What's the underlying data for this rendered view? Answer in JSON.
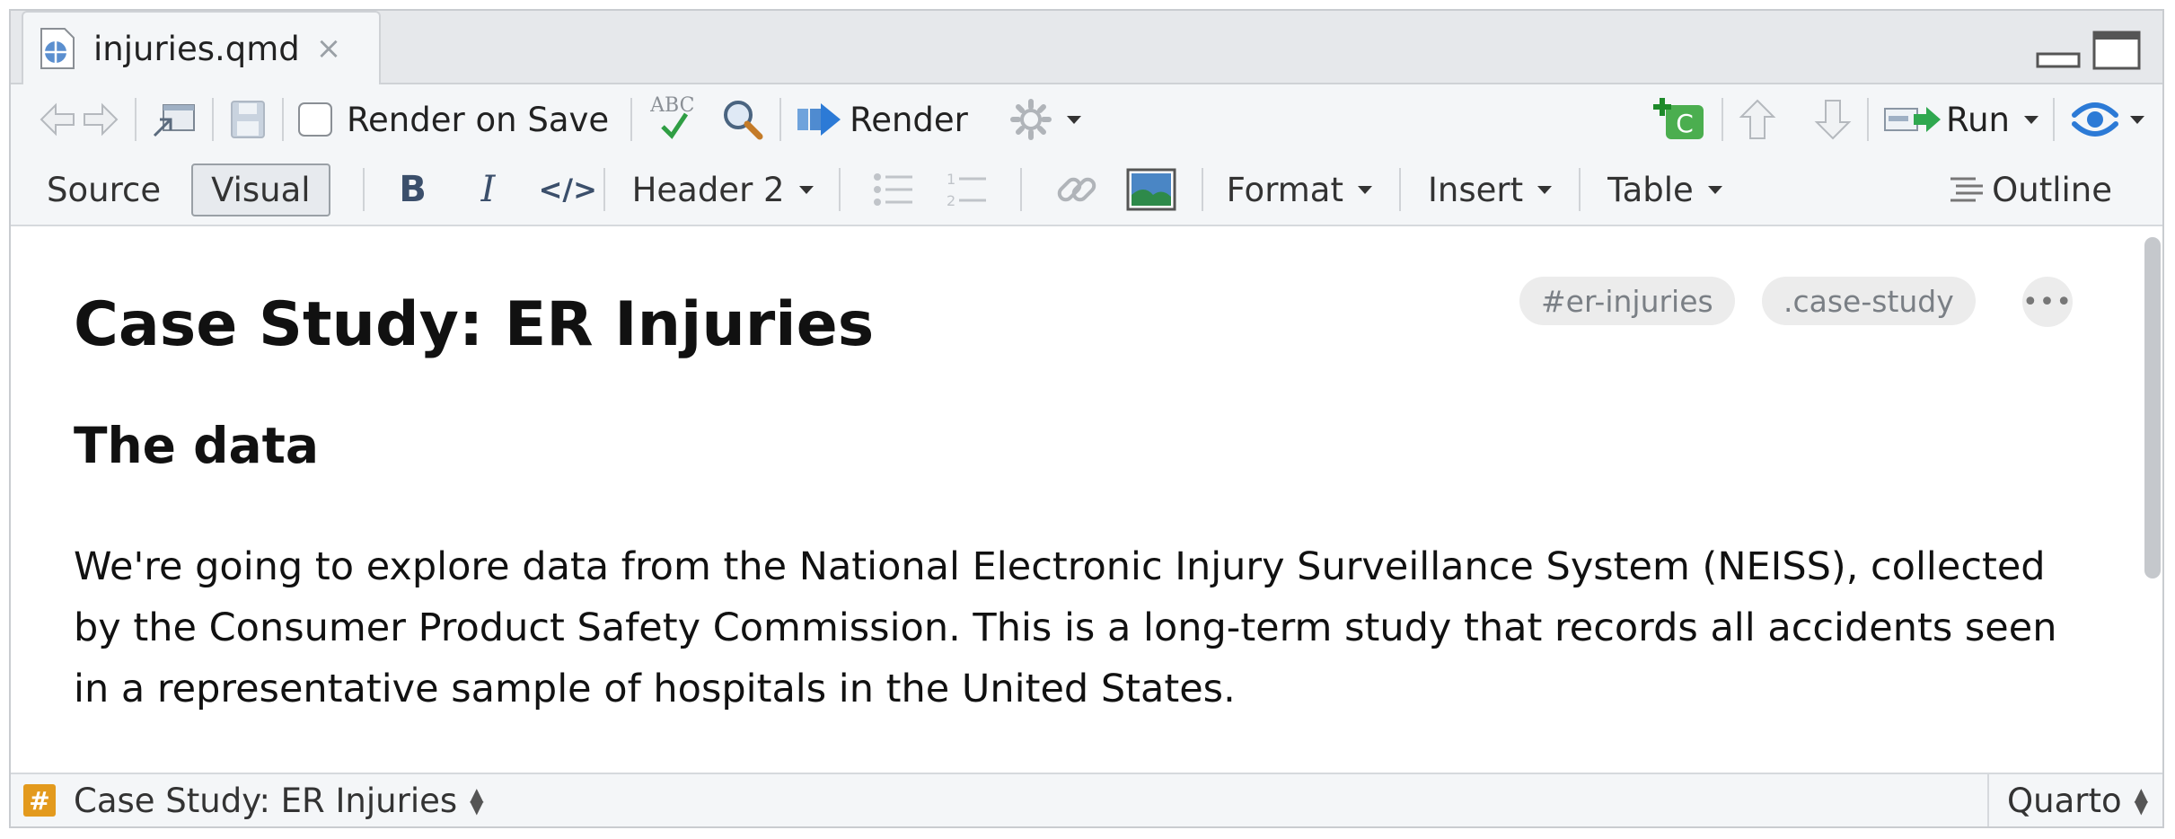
{
  "tab": {
    "filename": "injuries.qmd",
    "close": "×"
  },
  "toolbar": {
    "render_on_save": "Render on Save",
    "spell_label": "ABC",
    "render": "Render",
    "run": "Run"
  },
  "format_bar": {
    "source": "Source",
    "visual": "Visual",
    "bold": "B",
    "italic": "I",
    "code": "</>",
    "block_type": "Header 2",
    "format": "Format",
    "insert": "Insert",
    "table": "Table",
    "outline": "Outline"
  },
  "document": {
    "h1": "Case Study: ER Injuries",
    "chips": [
      "#er-injuries",
      ".case-study"
    ],
    "more": "•••",
    "h2": "The data",
    "paragraph": "We're going to explore data from the National Electronic Injury Surveillance System (NEISS), collected by the Consumer Product Safety Commission. This is a long-term study that records all accidents seen in a representative sample of hospitals in the United States."
  },
  "status": {
    "section_icon": "#",
    "section": "Case Study: ER Injuries",
    "mode": "Quarto"
  },
  "colors": {
    "accent_blue": "#2c7ad6",
    "section_badge": "#e39a1d",
    "chunk_green": "#4bae4f"
  }
}
